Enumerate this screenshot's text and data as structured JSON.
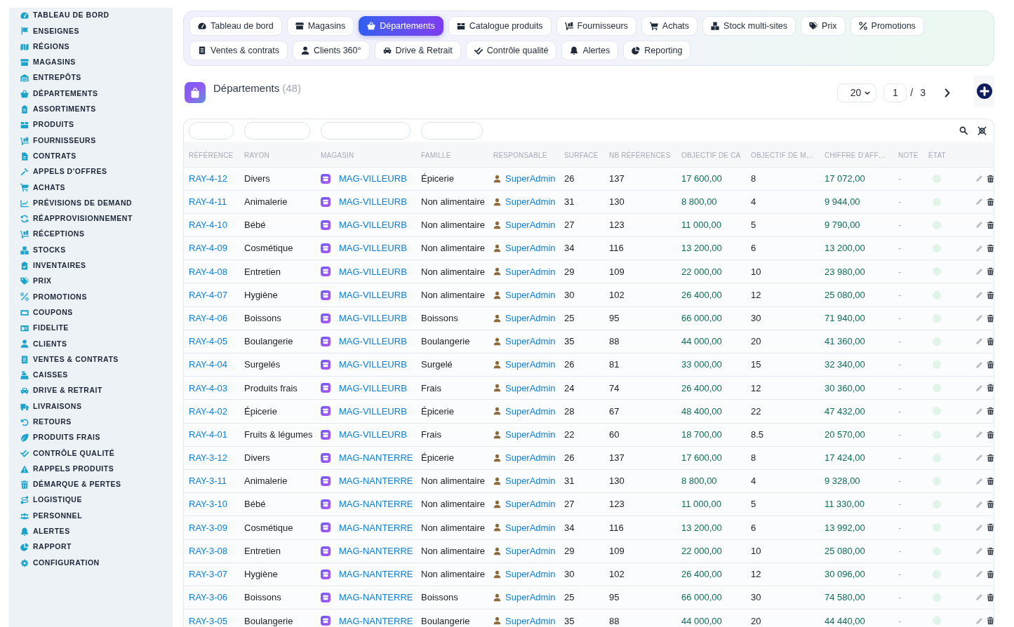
{
  "sidebar": {
    "items": [
      "TABLEAU DE BORD",
      "ENSEIGNES",
      "RÉGIONS",
      "MAGASINS",
      "ENTREPÔTS",
      "DÉPARTEMENTS",
      "ASSORTIMENTS",
      "PRODUITS",
      "FOURNISSEURS",
      "CONTRATS",
      "APPELS D'OFFRES",
      "ACHATS",
      "PRÉVISIONS DE DEMAND",
      "RÉAPPROVISIONNEMENT",
      "RÉCEPTIONS",
      "STOCKS",
      "INVENTAIRES",
      "PRIX",
      "PROMOTIONS",
      "COUPONS",
      "FIDELITE",
      "CLIENTS",
      "VENTES & CONTRATS",
      "CAISSES",
      "DRIVE & RETRAIT",
      "LIVRAISONS",
      "RETOURS",
      "PRODUITS FRAIS",
      "CONTRÔLE QUALITÉ",
      "RAPPELS PRODUITS",
      "DÉMARQUE & PERTES",
      "LOGISTIQUE",
      "PERSONNEL",
      "ALERTES",
      "RAPPORT",
      "CONFIGURATION"
    ]
  },
  "tabs": [
    {
      "label": "Tableau de bord",
      "selected": false
    },
    {
      "label": "Magasins",
      "selected": false
    },
    {
      "label": "Départements",
      "selected": true
    },
    {
      "label": "Catalogue produits",
      "selected": false
    },
    {
      "label": "Fournisseurs",
      "selected": false
    },
    {
      "label": "Achats",
      "selected": false
    },
    {
      "label": "Stock multi-sites",
      "selected": false
    },
    {
      "label": "Prix",
      "selected": false
    },
    {
      "label": "Promotions",
      "selected": false
    },
    {
      "label": "Ventes & contrats",
      "selected": false
    },
    {
      "label": "Clients 360°",
      "selected": false
    },
    {
      "label": "Drive & Retrait",
      "selected": false
    },
    {
      "label": "Contrôle qualité",
      "selected": false
    },
    {
      "label": "Alertes",
      "selected": false
    },
    {
      "label": "Reporting",
      "selected": false
    }
  ],
  "header": {
    "title": "Départements",
    "count": "(48)"
  },
  "pagination": {
    "page_size": "20",
    "page": "1",
    "separator": "/",
    "total_pages": "3"
  },
  "table": {
    "columns": [
      {
        "label": "RÉFÉRENCE",
        "kind": "link",
        "filter": true
      },
      {
        "label": "RAYON",
        "kind": "text",
        "filter": true
      },
      {
        "label": "MAGASIN",
        "kind": "store",
        "filter": true
      },
      {
        "label": "FAMILLE",
        "kind": "text",
        "filter": true
      },
      {
        "label": "RESPONSABLE",
        "kind": "user",
        "filter": false
      },
      {
        "label": "SURFACE",
        "kind": "text",
        "filter": false
      },
      {
        "label": "NB RÉFÉRENCES",
        "kind": "text",
        "filter": false
      },
      {
        "label": "OBJECTIF DE CA",
        "kind": "amount",
        "filter": false
      },
      {
        "label": "OBJECTIF DE M…",
        "kind": "text",
        "filter": false
      },
      {
        "label": "CHIFFRE D'AFF…",
        "kind": "amount",
        "filter": false
      },
      {
        "label": "NOTE",
        "kind": "muted",
        "filter": false
      },
      {
        "label": "ÉTAT",
        "kind": "status",
        "filter": false
      }
    ],
    "rows": [
      {
        "cells": [
          "RAY-4-12",
          "Divers",
          "MAG-VILLEURB",
          "Épicerie",
          "SuperAdmin",
          "26",
          "137",
          "17 600,00",
          "8",
          "17 072,00",
          "-"
        ]
      },
      {
        "cells": [
          "RAY-4-11",
          "Animalerie",
          "MAG-VILLEURB",
          "Non alimentaire",
          "SuperAdmin",
          "31",
          "130",
          "8 800,00",
          "4",
          "9 944,00",
          "-"
        ]
      },
      {
        "cells": [
          "RAY-4-10",
          "Bébé",
          "MAG-VILLEURB",
          "Non alimentaire",
          "SuperAdmin",
          "27",
          "123",
          "11 000,00",
          "5",
          "9 790,00",
          "-"
        ]
      },
      {
        "cells": [
          "RAY-4-09",
          "Cosmétique",
          "MAG-VILLEURB",
          "Non alimentaire",
          "SuperAdmin",
          "34",
          "116",
          "13 200,00",
          "6",
          "13 200,00",
          "-"
        ]
      },
      {
        "cells": [
          "RAY-4-08",
          "Entretien",
          "MAG-VILLEURB",
          "Non alimentaire",
          "SuperAdmin",
          "29",
          "109",
          "22 000,00",
          "10",
          "23 980,00",
          "-"
        ]
      },
      {
        "cells": [
          "RAY-4-07",
          "Hygiène",
          "MAG-VILLEURB",
          "Non alimentaire",
          "SuperAdmin",
          "30",
          "102",
          "26 400,00",
          "12",
          "25 080,00",
          "-"
        ]
      },
      {
        "cells": [
          "RAY-4-06",
          "Boissons",
          "MAG-VILLEURB",
          "Boissons",
          "SuperAdmin",
          "25",
          "95",
          "66 000,00",
          "30",
          "71 940,00",
          "-"
        ]
      },
      {
        "cells": [
          "RAY-4-05",
          "Boulangerie",
          "MAG-VILLEURB",
          "Boulangerie",
          "SuperAdmin",
          "35",
          "88",
          "44 000,00",
          "20",
          "41 360,00",
          "-"
        ]
      },
      {
        "cells": [
          "RAY-4-04",
          "Surgelés",
          "MAG-VILLEURB",
          "Surgelé",
          "SuperAdmin",
          "26",
          "81",
          "33 000,00",
          "15",
          "32 340,00",
          "-"
        ]
      },
      {
        "cells": [
          "RAY-4-03",
          "Produits frais",
          "MAG-VILLEURB",
          "Frais",
          "SuperAdmin",
          "24",
          "74",
          "26 400,00",
          "12",
          "30 360,00",
          "-"
        ]
      },
      {
        "cells": [
          "RAY-4-02",
          "Épicerie",
          "MAG-VILLEURB",
          "Épicerie",
          "SuperAdmin",
          "28",
          "67",
          "48 400,00",
          "22",
          "47 432,00",
          "-"
        ]
      },
      {
        "cells": [
          "RAY-4-01",
          "Fruits & légumes",
          "MAG-VILLEURB",
          "Frais",
          "SuperAdmin",
          "22",
          "60",
          "18 700,00",
          "8.5",
          "20 570,00",
          "-"
        ]
      },
      {
        "cells": [
          "RAY-3-12",
          "Divers",
          "MAG-NANTERRE",
          "Épicerie",
          "SuperAdmin",
          "26",
          "137",
          "17 600,00",
          "8",
          "17 424,00",
          "-"
        ]
      },
      {
        "cells": [
          "RAY-3-11",
          "Animalerie",
          "MAG-NANTERRE",
          "Non alimentaire",
          "SuperAdmin",
          "31",
          "130",
          "8 800,00",
          "4",
          "9 328,00",
          "-"
        ]
      },
      {
        "cells": [
          "RAY-3-10",
          "Bébé",
          "MAG-NANTERRE",
          "Non alimentaire",
          "SuperAdmin",
          "27",
          "123",
          "11 000,00",
          "5",
          "11 330,00",
          "-"
        ]
      },
      {
        "cells": [
          "RAY-3-09",
          "Cosmétique",
          "MAG-NANTERRE",
          "Non alimentaire",
          "SuperAdmin",
          "34",
          "116",
          "13 200,00",
          "6",
          "13 992,00",
          "-"
        ]
      },
      {
        "cells": [
          "RAY-3-08",
          "Entretien",
          "MAG-NANTERRE",
          "Non alimentaire",
          "SuperAdmin",
          "29",
          "109",
          "22 000,00",
          "10",
          "25 080,00",
          "-"
        ]
      },
      {
        "cells": [
          "RAY-3-07",
          "Hygiène",
          "MAG-NANTERRE",
          "Non alimentaire",
          "SuperAdmin",
          "30",
          "102",
          "26 400,00",
          "12",
          "30 096,00",
          "-"
        ]
      },
      {
        "cells": [
          "RAY-3-06",
          "Boissons",
          "MAG-NANTERRE",
          "Boissons",
          "SuperAdmin",
          "25",
          "95",
          "66 000,00",
          "30",
          "74 580,00",
          "-"
        ]
      },
      {
        "cells": [
          "RAY-3-05",
          "Boulangerie",
          "MAG-NANTERRE",
          "Boulangerie",
          "SuperAdmin",
          "35",
          "88",
          "44 000,00",
          "20",
          "44 440,00",
          "-"
        ]
      }
    ]
  }
}
